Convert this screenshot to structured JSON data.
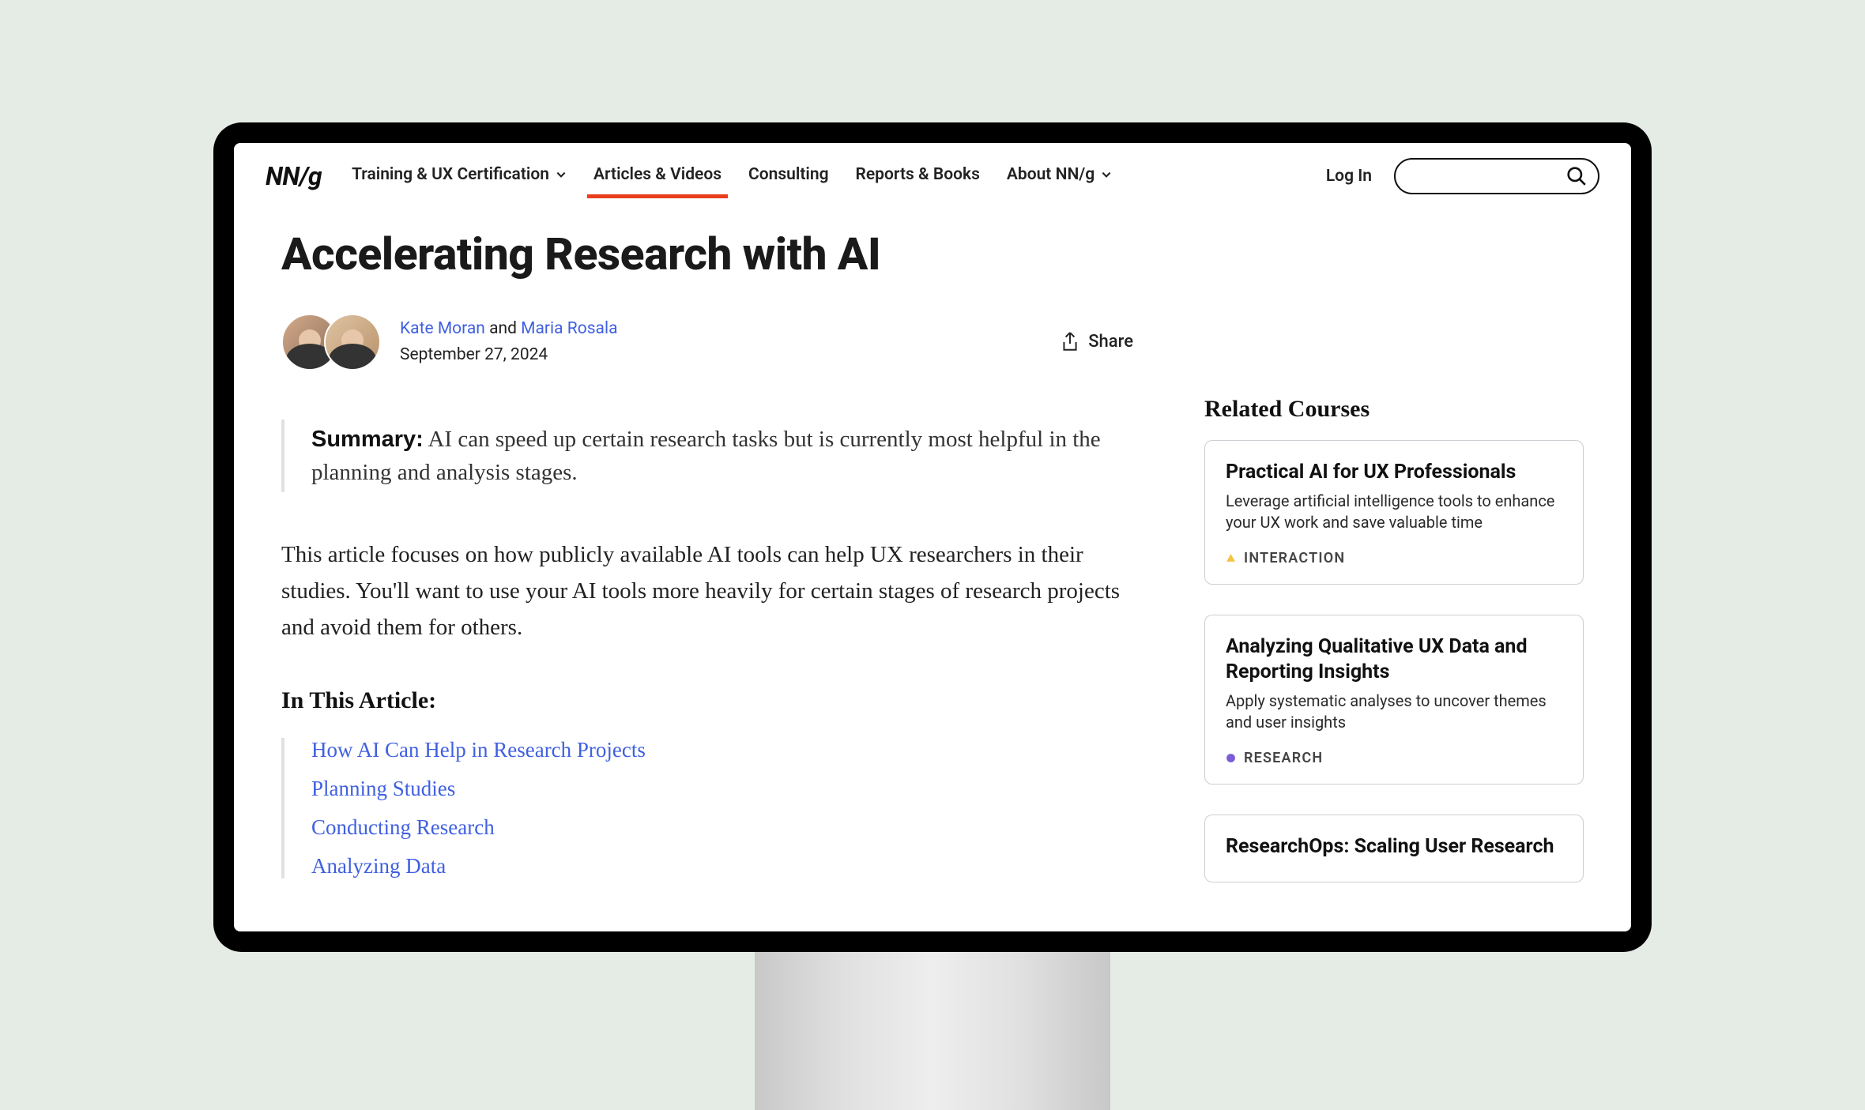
{
  "logo": "NN/g",
  "nav": {
    "items": [
      {
        "label": "Training & UX Certification",
        "hasDropdown": true
      },
      {
        "label": "Articles & Videos",
        "hasDropdown": false,
        "active": true
      },
      {
        "label": "Consulting",
        "hasDropdown": false
      },
      {
        "label": "Reports & Books",
        "hasDropdown": false
      },
      {
        "label": "About NN/g",
        "hasDropdown": true
      }
    ]
  },
  "header": {
    "login": "Log In"
  },
  "article": {
    "title": "Accelerating Research with AI",
    "authors": [
      {
        "name": "Kate Moran"
      },
      {
        "name": "Maria Rosala"
      }
    ],
    "authorJoin": "and",
    "date": "September 27, 2024",
    "share": "Share",
    "summaryLabel": "Summary:",
    "summaryText": " AI can speed up certain research tasks but is currently most helpful in the planning and analysis stages.",
    "bodyPara1": "This article focuses on how publicly available AI tools can help UX researchers in their studies. You'll want to use your AI tools more heavily for certain stages of research projects and avoid them for others.",
    "tocHeading": "In This Article:",
    "toc": [
      "How AI Can Help in Research Projects",
      "Planning Studies",
      "Conducting Research",
      "Analyzing Data"
    ]
  },
  "sidebar": {
    "heading": "Related Courses",
    "courses": [
      {
        "title": "Practical AI for UX Professionals",
        "desc": "Leverage artificial intelligence tools to enhance your UX work and save valuable time",
        "tag": "INTERACTION",
        "tagIcon": "triangle",
        "tagColor": "#f5c342"
      },
      {
        "title": "Analyzing Qualitative UX Data and Reporting Insights",
        "desc": "Apply systematic analyses to uncover themes and user insights",
        "tag": "RESEARCH",
        "tagIcon": "circle",
        "tagColor": "#7b5cd6"
      },
      {
        "title": "ResearchOps: Scaling User Research",
        "desc": "",
        "tag": "",
        "tagIcon": "",
        "tagColor": ""
      }
    ]
  }
}
